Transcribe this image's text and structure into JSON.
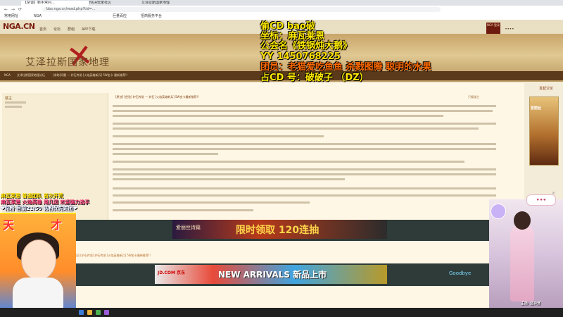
{
  "browser": {
    "tabs": [
      "【杂谈】新手常问...",
      "NGA玩家社区",
      "艾泽拉斯国家地理"
    ],
    "url": "bbs.nga.cn/read.php?tid=...",
    "bookmarks": [
      "常用网址",
      "NGA",
      "巨量百应",
      "招商服务平台"
    ]
  },
  "site": {
    "logo": "NGA.CN",
    "nav": [
      "首页",
      "论坛",
      "群组",
      "APP下载"
    ],
    "banner_title": "艾泽拉斯国家地理",
    "user_box": "NGA 登录"
  },
  "crumbs": [
    "NGA",
    "艾泽拉斯国家地理论坛",
    "[求助]问题 — 炉石传说 [火焰英雄新兵] 5W金卡 最新推荐!!"
  ],
  "overlay": {
    "line1": "偷CD    bao破",
    "line2": "坐标：麻瓦莱恩",
    "line3": "公会名《铁锅炖大鹅》",
    "line4": "YY  1450768225",
    "line5": "团员：老猫爱吃鱼鱼 杀戮图腾 聪明的水果",
    "line6": "占CD 号：破破子 （DZ）"
  },
  "post": {
    "title": "[原创] [经验] 炉石传说 — 炉石 [火焰英雄新兵] 5W金卡最新推荐!!",
    "quick_links": [
      "只看楼主",
      "回复"
    ],
    "author_label": "楼主",
    "thread_link": "返回 [炉石传说] 炉石传说 [火焰英雄新兵] 5W金卡最新推荐!!"
  },
  "sidebar": {
    "tab_label": "发起讨论",
    "ad_text": "爱丽丝"
  },
  "ads": {
    "ad1_left": "爱丽丝诗篇",
    "ad1_main": "限时领取 120连抽",
    "ad2_logo": "JD.COM 京东",
    "ad2_text": "NEW ARRIVALS 新品上市",
    "goodbye": "Goodbye"
  },
  "streamer": {
    "line1": "麻瓦莱恩 普通团队 首次开荒",
    "line2": "麻瓦莱恩 火焰英雄 周几团 欢迎强力选手",
    "line3": "❤钻粉 目前21/50 钻粉优先进团❤",
    "sticker_left": "天",
    "sticker_right": "才",
    "right_name": "主播: 蓝染酱"
  },
  "colors": {
    "overlay_yellow": "#ffea00",
    "overlay_orange": "#ff6a00",
    "nga_red": "#7a1c0e"
  }
}
